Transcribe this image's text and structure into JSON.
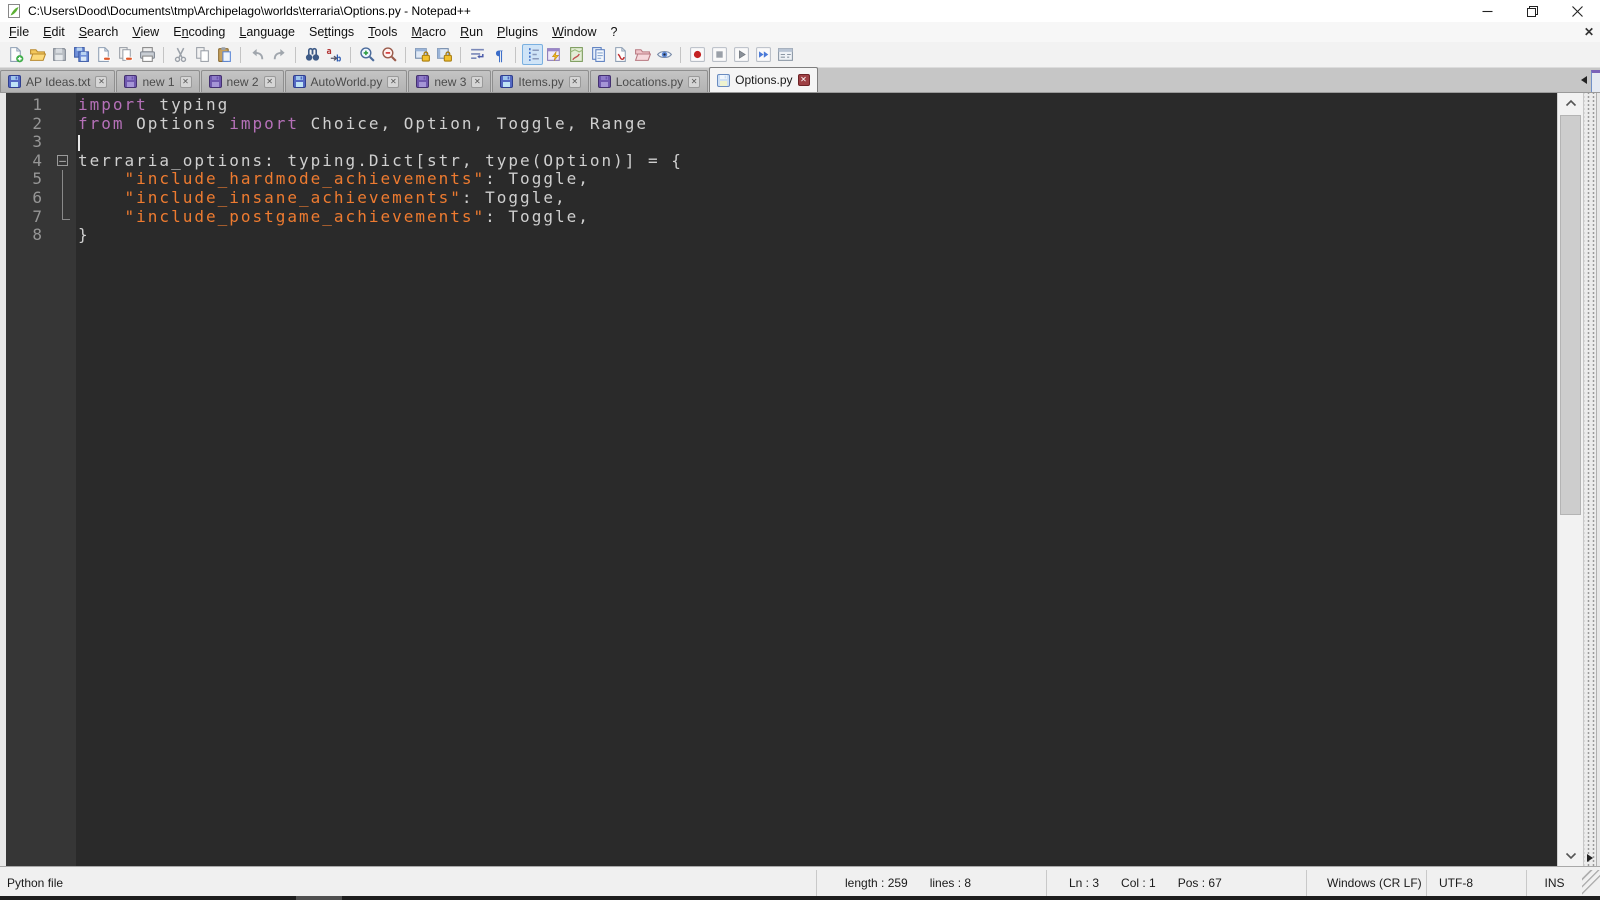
{
  "colors": {
    "keyword": "#b570b8",
    "string": "#ee7b30",
    "text": "#cfcfcf",
    "editor_bg": "#2a2a2a",
    "gutter_bg": "#363636",
    "accent_tab_close": "#9e4044"
  },
  "window": {
    "title": "C:\\Users\\Dood\\Documents\\tmp\\Archipelago\\worlds\\terraria\\Options.py - Notepad++",
    "controls": {
      "minimize": "minimize",
      "restore": "restore",
      "close": "close"
    }
  },
  "menu": {
    "items": [
      {
        "label": "File",
        "u": 0
      },
      {
        "label": "Edit",
        "u": 0
      },
      {
        "label": "Search",
        "u": 0
      },
      {
        "label": "View",
        "u": 0
      },
      {
        "label": "Encoding",
        "u": 1
      },
      {
        "label": "Language",
        "u": 0
      },
      {
        "label": "Settings",
        "u": 2
      },
      {
        "label": "Tools",
        "u": 0
      },
      {
        "label": "Macro",
        "u": 0
      },
      {
        "label": "Run",
        "u": 0
      },
      {
        "label": "Plugins",
        "u": 0
      },
      {
        "label": "Window",
        "u": 0
      },
      {
        "label": "?",
        "u": -1
      }
    ],
    "close_document_x": "✕"
  },
  "toolbar": {
    "groups": [
      [
        "new-file",
        "open-file",
        "save",
        "save-all",
        "close",
        "close-all",
        "print"
      ],
      [
        "cut",
        "copy",
        "paste"
      ],
      [
        "undo",
        "redo"
      ],
      [
        "find",
        "replace"
      ],
      [
        "zoom-in",
        "zoom-out"
      ],
      [
        "sync-scroll-vertical",
        "sync-scroll-horizontal"
      ],
      [
        "word-wrap",
        "show-all-characters"
      ],
      [
        "show-indent-guide",
        "function-list",
        "document-map",
        "document-list",
        "user-defined-language",
        "project-panel",
        "view-monitoring"
      ],
      [
        "record-macro",
        "stop-macro",
        "play-macro",
        "run-macro-multiple",
        "save-recorded-macro"
      ]
    ],
    "pressed": [
      "show-indent-guide"
    ]
  },
  "tabs": [
    {
      "label": "AP Ideas.txt",
      "modified": false,
      "active": false
    },
    {
      "label": "new 1",
      "modified": true,
      "active": false
    },
    {
      "label": "new 2",
      "modified": true,
      "active": false
    },
    {
      "label": "AutoWorld.py",
      "modified": false,
      "active": false
    },
    {
      "label": "new 3",
      "modified": true,
      "active": false
    },
    {
      "label": "Items.py",
      "modified": false,
      "active": false
    },
    {
      "label": "Locations.py",
      "modified": true,
      "active": false
    },
    {
      "label": "Options.py",
      "modified": false,
      "active": true
    }
  ],
  "editor": {
    "language": "Python",
    "lines": [
      {
        "n": "1",
        "fold": "",
        "caret": false,
        "segs": [
          [
            "kw",
            "import"
          ],
          [
            "txt",
            " typing"
          ]
        ]
      },
      {
        "n": "2",
        "fold": "",
        "caret": false,
        "segs": [
          [
            "kw",
            "from"
          ],
          [
            "txt",
            " Options "
          ],
          [
            "kw",
            "import"
          ],
          [
            "txt",
            " Choice, Option, Toggle, Range"
          ]
        ]
      },
      {
        "n": "3",
        "fold": "",
        "caret": true,
        "segs": []
      },
      {
        "n": "4",
        "fold": "open",
        "caret": false,
        "segs": [
          [
            "txt",
            "terraria_options: typing.Dict[str, type(Option)] = {"
          ]
        ]
      },
      {
        "n": "5",
        "fold": "line",
        "caret": false,
        "segs": [
          [
            "txt",
            "    "
          ],
          [
            "str",
            "\"include_hardmode_achievements\""
          ],
          [
            "txt",
            ": Toggle,"
          ]
        ]
      },
      {
        "n": "6",
        "fold": "line",
        "caret": false,
        "segs": [
          [
            "txt",
            "    "
          ],
          [
            "str",
            "\"include_insane_achievements\""
          ],
          [
            "txt",
            ": Toggle,"
          ]
        ]
      },
      {
        "n": "7",
        "fold": "corner",
        "caret": false,
        "segs": [
          [
            "txt",
            "    "
          ],
          [
            "str",
            "\"include_postgame_achievements\""
          ],
          [
            "txt",
            ": Toggle,"
          ]
        ]
      },
      {
        "n": "8",
        "fold": "",
        "caret": false,
        "segs": [
          [
            "txt",
            "}"
          ]
        ]
      }
    ]
  },
  "status_bar": {
    "sections": [
      {
        "cls": "file-type",
        "name": "file-type",
        "texts": [
          "Python file"
        ]
      },
      {
        "cls": "doc-size",
        "name": "document-size",
        "texts": [
          "length : 259",
          "lines : 8"
        ]
      },
      {
        "cls": "cursor-pos",
        "name": "cursor-position",
        "texts": [
          "Ln : 3",
          "Col : 1",
          "Pos : 67"
        ]
      },
      {
        "cls": "eol",
        "name": "eol-format",
        "texts": [
          "Windows (CR LF)"
        ]
      },
      {
        "cls": "encoding",
        "name": "encoding",
        "texts": [
          "UTF-8"
        ]
      },
      {
        "cls": "insert-mode",
        "name": "insert-mode",
        "texts": [
          "INS"
        ]
      }
    ]
  }
}
